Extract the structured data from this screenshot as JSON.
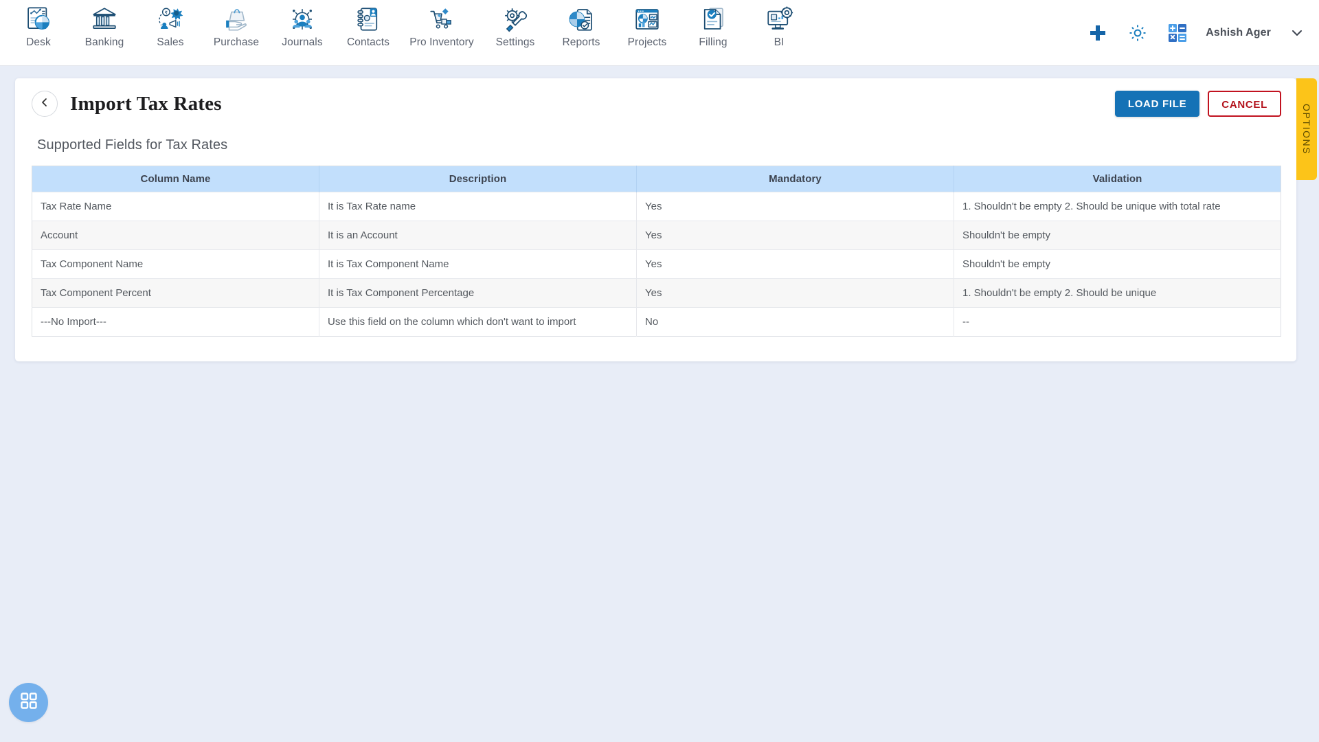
{
  "nav": {
    "items": [
      {
        "label": "Desk",
        "icon": "dashboard-chart-icon"
      },
      {
        "label": "Banking",
        "icon": "bank-building-icon"
      },
      {
        "label": "Sales",
        "icon": "sales-megaphone-icon"
      },
      {
        "label": "Purchase",
        "icon": "purchase-bag-hand-icon"
      },
      {
        "label": "Journals",
        "icon": "journals-gear-people-icon"
      },
      {
        "label": "Contacts",
        "icon": "contacts-book-icon"
      },
      {
        "label": "Pro Inventory",
        "icon": "inventory-cart-icon"
      },
      {
        "label": "Settings",
        "icon": "settings-gear-wrench-icon"
      },
      {
        "label": "Reports",
        "icon": "reports-piechart-icon"
      },
      {
        "label": "Projects",
        "icon": "projects-dashboard-icon"
      },
      {
        "label": "Filling",
        "icon": "filling-documents-check-icon"
      },
      {
        "label": "BI",
        "icon": "bi-monitor-gear-icon"
      }
    ],
    "actions": [
      {
        "name": "add-icon",
        "title": "Add"
      },
      {
        "name": "gear-icon",
        "title": "Settings"
      },
      {
        "name": "calculator-icon",
        "title": "Calculator"
      }
    ],
    "user": "Ashish Ager"
  },
  "header": {
    "title": "Import Tax Rates",
    "back_icon": "chevron-left-icon",
    "load_file_label": "LOAD FILE",
    "cancel_label": "CANCEL",
    "options_tab_label": "OPTIONS"
  },
  "content": {
    "section_title": "Supported Fields for Tax Rates",
    "table": {
      "columns": [
        "Column Name",
        "Description",
        "Mandatory",
        "Validation"
      ],
      "rows": [
        {
          "column_name": "Tax Rate Name",
          "description": "It is Tax Rate name",
          "mandatory": "Yes",
          "validation": "1. Shouldn't be empty 2. Should be unique with total rate"
        },
        {
          "column_name": "Account",
          "description": "It is an Account",
          "mandatory": "Yes",
          "validation": "Shouldn't be empty"
        },
        {
          "column_name": "Tax Component Name",
          "description": "It is Tax Component Name",
          "mandatory": "Yes",
          "validation": "Shouldn't be empty"
        },
        {
          "column_name": "Tax Component Percent",
          "description": "It is Tax Component Percentage",
          "mandatory": "Yes",
          "validation": "1. Shouldn't be empty 2. Should be unique"
        },
        {
          "column_name": "---No Import---",
          "description": "Use this field on the column which don't want to import",
          "mandatory": "No",
          "validation": "--"
        }
      ]
    }
  },
  "fab": {
    "icon": "grid-apps-icon"
  },
  "colors": {
    "primary": "#1572b6",
    "danger": "#c1121f",
    "table_header": "#c2dffc",
    "options_tab": "#fcc419",
    "page_background": "#e8edf7",
    "fab": "#74b0ec"
  }
}
